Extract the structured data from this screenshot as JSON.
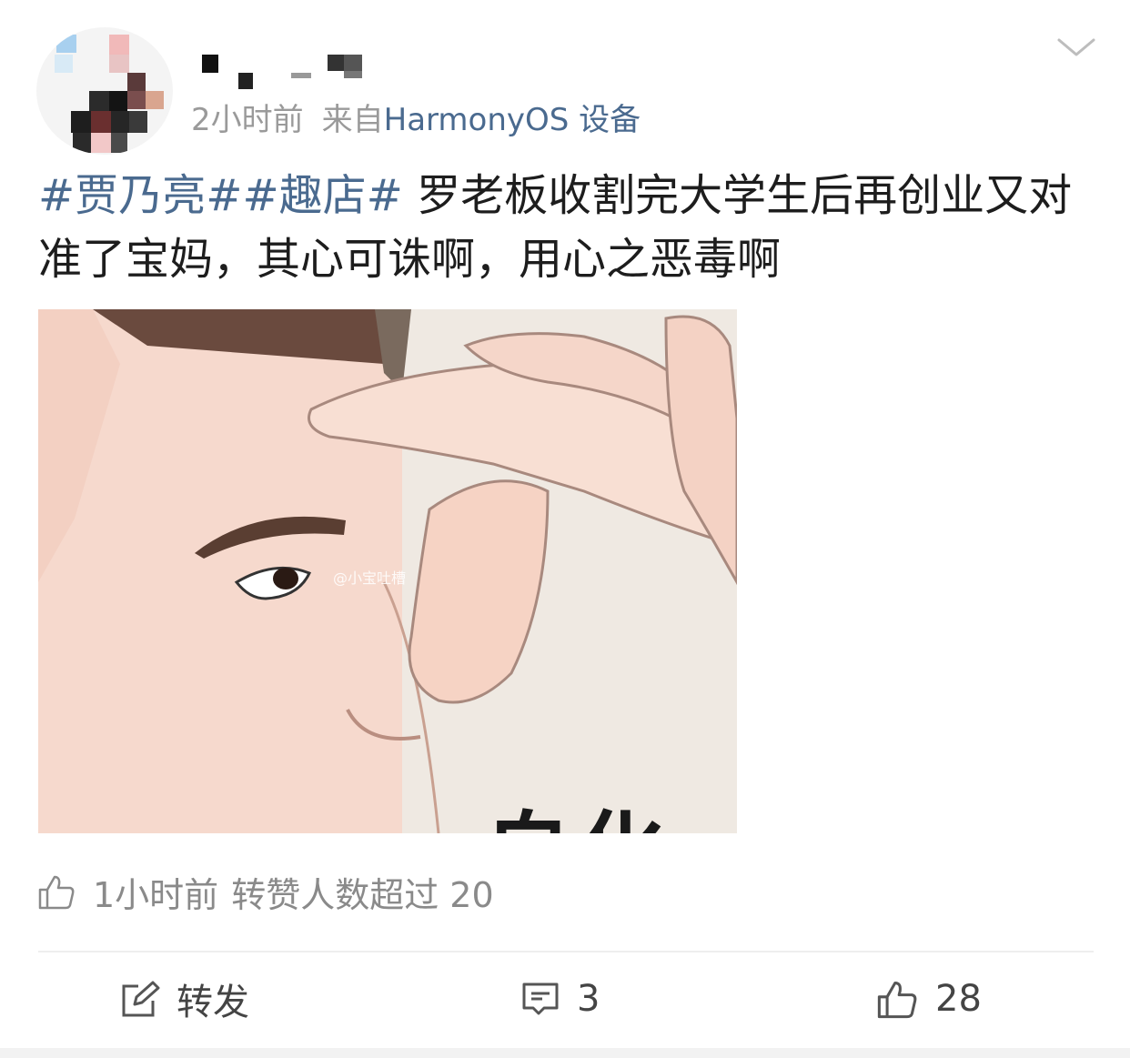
{
  "post": {
    "time": "2小时前",
    "source_prefix": "来自",
    "source_device": "HarmonyOS 设备",
    "tags": [
      "#贾乃亮#",
      "#趣店#"
    ],
    "text": " 罗老板收割完大学生后再创业又对准了宝妈，其心可诛啊，用心之恶毒啊",
    "image": {
      "caption": "自化",
      "watermark": "@小宝吐槽"
    }
  },
  "info": {
    "time": "1小时前",
    "text": "转赞人数超过 20"
  },
  "actions": {
    "repost_label": "转发",
    "comment_count": "3",
    "like_count": "28"
  },
  "icons": {
    "more": "chevron-down-icon",
    "thumb": "thumb-up-icon",
    "repost": "repost-icon",
    "comment": "comment-icon"
  }
}
